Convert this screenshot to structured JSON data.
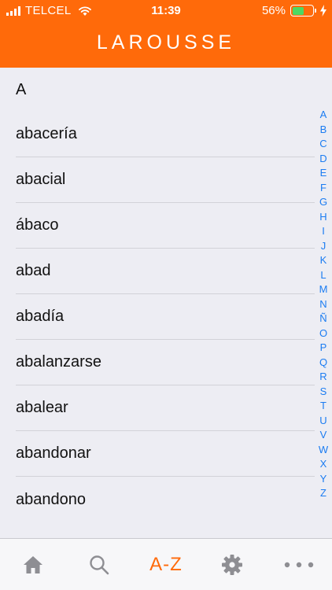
{
  "status_bar": {
    "carrier": "TELCEL",
    "time": "11:39",
    "battery_percent": "56%",
    "battery_level": 0.56,
    "battery_color": "#4cd964"
  },
  "header": {
    "title": "LAROUSSE",
    "background_color": "#ff6a0a"
  },
  "list": {
    "section": "A",
    "items": [
      "abacería",
      "abacial",
      "ábaco",
      "abad",
      "abadía",
      "abalanzarse",
      "abalear",
      "abandonar",
      "abandono"
    ]
  },
  "alphabet_index": [
    "A",
    "B",
    "C",
    "D",
    "E",
    "F",
    "G",
    "H",
    "I",
    "J",
    "K",
    "L",
    "M",
    "N",
    "Ñ",
    "O",
    "P",
    "Q",
    "R",
    "S",
    "T",
    "U",
    "V",
    "W",
    "X",
    "Y",
    "Z"
  ],
  "index_color": "#1b7cf2",
  "tabbar": {
    "tabs": [
      {
        "name": "home",
        "icon": "home-icon"
      },
      {
        "name": "search",
        "icon": "search-icon"
      },
      {
        "name": "a-z",
        "label": "A-Z",
        "active": true
      },
      {
        "name": "settings",
        "icon": "gear-icon"
      },
      {
        "name": "more",
        "icon": "more-icon"
      }
    ],
    "active_color": "#ff6a0a",
    "inactive_color": "#8e8e93"
  }
}
